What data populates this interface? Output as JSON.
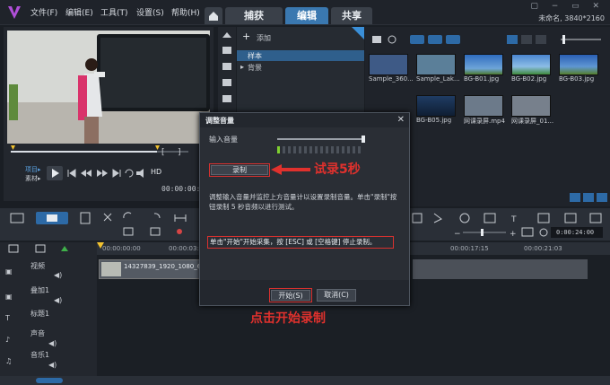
{
  "app": {
    "menu": [
      "文件(F)",
      "编辑(E)",
      "工具(T)",
      "设置(S)",
      "帮助(H)"
    ],
    "tabs": [
      {
        "label": "捕获",
        "active": false
      },
      {
        "label": "编辑",
        "active": true
      },
      {
        "label": "共享",
        "active": false
      }
    ],
    "project_info": "未命名, 3840*2160"
  },
  "preview": {
    "mode_labels": [
      "项目▸",
      "素材▸"
    ],
    "hd_label": "HD",
    "timecode": "00:00:00:00"
  },
  "library": {
    "add_label": "添加",
    "folders": [
      "样本",
      "背景"
    ],
    "thumbnails": [
      {
        "label": "Sample_360...",
        "color": "#3e5a86"
      },
      {
        "label": "Sample_Lak...",
        "color": "#5b7f99"
      },
      {
        "label": "BG-B01.jpg",
        "color": "#2f6dbf"
      },
      {
        "label": "BG-B02.jpg",
        "color": "#3f8a3a"
      },
      {
        "label": "BG-B03.jpg",
        "color": "#2a5fb4"
      },
      {
        "label": "BG-B05.jpg",
        "color": "#1f3c63"
      },
      {
        "label": "网课录屏.mp4",
        "color": "#6c7a8a"
      },
      {
        "label": "网课录屏_01...",
        "color": "#77808c"
      }
    ]
  },
  "timeline": {
    "ruler": [
      "00:00:00:00",
      "00:00:03:1",
      "00:00:17:15",
      "00:00:21:03"
    ],
    "timecode": "0:00:24:00",
    "clip_label": "14327839_1920_1080_60fp",
    "tracks": [
      "视频",
      "叠加1",
      "标题1",
      "声音",
      "音乐1"
    ]
  },
  "dialog": {
    "title": "调整音量",
    "input_label": "输入音量",
    "record_button": "录制",
    "description": "调整输入音量并监控上方音量计以设置录制音量。单击\"录制\"按钮录制 5 秒音频以进行测试。",
    "instruction": "单击\"开始\"开始采集，按 [ESC] 或 [空格键] 停止录制。",
    "start_button": "开始(S)",
    "cancel_button": "取消(C)"
  },
  "annotations": {
    "test_record": "试录5秒",
    "click_start": "点击开始录制"
  },
  "colors": {
    "accent": "#3a78b0",
    "annotation_red": "#e0312d"
  }
}
